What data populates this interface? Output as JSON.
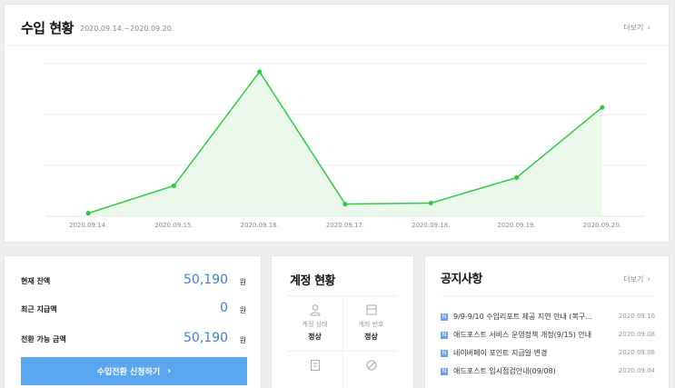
{
  "income": {
    "title": "수입 현황",
    "date_range": "2020.09.14.~2020.09.20.",
    "more_label": "더보기"
  },
  "chart_data": {
    "type": "area",
    "categories": [
      "2020.09.14.",
      "2020.09.15.",
      "2020.09.16.",
      "2020.09.17.",
      "2020.09.18.",
      "2020.09.19.",
      "2020.09.20."
    ],
    "series": [
      {
        "values": [
          3,
          30,
          142,
          12,
          13,
          38,
          107
        ]
      }
    ],
    "ylim": [
      0,
      150
    ],
    "grid": true,
    "colors": {
      "line": "#2ecc40",
      "fill": "#eaf9ec"
    }
  },
  "balance": {
    "rows": [
      {
        "label": "현재 잔액",
        "value": "50,190",
        "unit": "원"
      },
      {
        "label": "최근 지급액",
        "value": "0",
        "unit": "원"
      },
      {
        "label": "전환 가능 금액",
        "value": "50,190",
        "unit": "원"
      }
    ],
    "button_label": "수입전환 신청하기",
    "accent": "#3d7fd7"
  },
  "account": {
    "title": "계정 현황",
    "cells": [
      {
        "label": "계정 상태",
        "value": "정상",
        "icon": "user-icon"
      },
      {
        "label": "계좌 번호",
        "value": "정상",
        "icon": "bank-card-icon"
      },
      {
        "label": "",
        "value": "",
        "icon": "document-icon"
      },
      {
        "label": "",
        "value": "",
        "icon": "block-icon"
      }
    ]
  },
  "notices": {
    "title": "공지사항",
    "more_label": "더보기",
    "items": [
      {
        "title": "9/9-9/10 수입리포트 제공 지연 안내 (복구...",
        "date": "2020.09.10"
      },
      {
        "title": "애드포스트 서비스 운영정책 개정(9/15) 안내",
        "date": "2020.09.08"
      },
      {
        "title": "네이버페이 포인트 지급일 변경",
        "date": "2020.09.08"
      },
      {
        "title": "애드포스트 임시점검안내(09/08)",
        "date": "2020.09.04"
      }
    ]
  }
}
